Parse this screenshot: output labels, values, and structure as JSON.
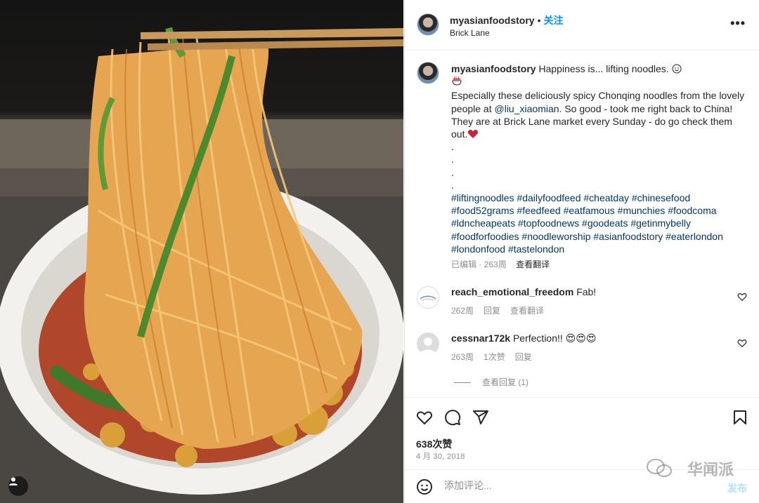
{
  "header": {
    "username": "myasianfoodstory",
    "separator": "•",
    "follow_label": "关注",
    "location": "Brick Lane",
    "more_label": "•••"
  },
  "caption": {
    "username": "myasianfoodstory",
    "line1": "Happiness is... lifting noodles.",
    "body_pre": "Especially these deliciously spicy Chonqing noodles from the lovely people at ",
    "mention": "@liu_xiaomian",
    "body_post": ". So good - took me right back to China! They are at Brick Lane market every Sunday - do go check them out.",
    "dots": [
      ".",
      ".",
      ".",
      "."
    ],
    "hashtags": [
      "#liftingnoodles",
      "#dailyfoodfeed",
      "#cheatday",
      "#chinesefood",
      "#food52grams",
      "#feedfeed",
      "#eatfamous",
      "#munchies",
      "#foodcoma",
      "#ldncheapeats",
      "#topfoodnews",
      "#goodeats",
      "#getinmybelly",
      "#foodforfoodies",
      "#noodleworship",
      "#asianfoodstory",
      "#eaterlondon",
      "#londonfood",
      "#tastelondon"
    ],
    "edited": "已编辑",
    "sep": "·",
    "age": "263周",
    "translate": "查看翻译"
  },
  "comments": [
    {
      "username": "reach_emotional_freedom",
      "text": "Fab!",
      "age": "262周",
      "reply": "回复",
      "translate": "查看翻译"
    },
    {
      "username": "cessnar172k",
      "text": "Perfection!! 😍😍😍",
      "age": "263周",
      "likes": "1次赞",
      "reply": "回复"
    }
  ],
  "view_replies": "查看回复 (1)",
  "likes": "638次赞",
  "date": "4 月 30, 2018",
  "add_comment": {
    "placeholder": "添加评论...",
    "post_label": "发布"
  },
  "watermark": "华闻派",
  "colors": {
    "link": "#00376b",
    "follow": "#0095f6",
    "muted": "#8e8e8e",
    "post_disabled": "#b2dffc"
  }
}
